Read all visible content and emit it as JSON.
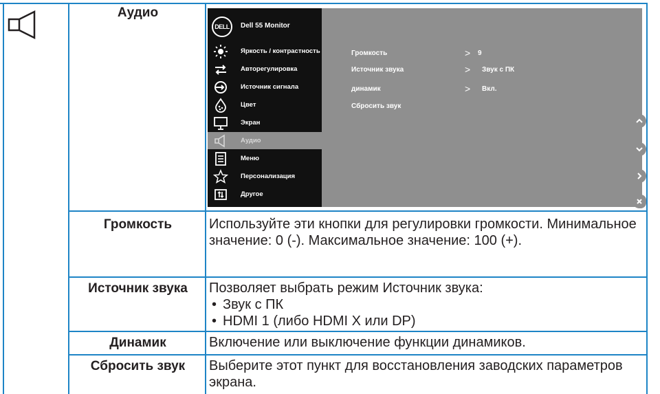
{
  "title": "Аудио",
  "osd": {
    "brand_logo": "DELL",
    "monitor_title": "Dell 55 Monitor",
    "menu_items": [
      {
        "icon": "brightness-icon",
        "label": "Яркость / контрастность"
      },
      {
        "icon": "auto-adjust-icon",
        "label": "Авторегулировка"
      },
      {
        "icon": "input-source-icon",
        "label": "Источник сигнала"
      },
      {
        "icon": "color-icon",
        "label": "Цвет"
      },
      {
        "icon": "display-icon",
        "label": "Экран"
      },
      {
        "icon": "speaker-icon",
        "label": "Аудио",
        "active": true
      },
      {
        "icon": "menu-icon",
        "label": "Меню"
      },
      {
        "icon": "star-icon",
        "label": "Персонализация"
      },
      {
        "icon": "others-icon",
        "label": "Другое"
      }
    ],
    "submenu": [
      {
        "name": "Громкость",
        "value": "9"
      },
      {
        "name": "Источник звука",
        "value": "Звук с ПК"
      },
      {
        "name": "динамик",
        "value": "Вкл."
      },
      {
        "name": "Сбросить звук",
        "value": ""
      }
    ],
    "nav_buttons": [
      "up",
      "down",
      "right",
      "exit"
    ]
  },
  "rows": [
    {
      "label": "Громкость",
      "description": "Используйте эти кнопки для регулировки громкости. Минимальное значение: 0 (-). Максимальное значение: 100 (+)."
    },
    {
      "label": "Источник звука",
      "description": "Позволяет выбрать режим Источник звука:",
      "bullets": [
        "Звук с ПК",
        "HDMI 1 (либо HDMI X или DP)"
      ]
    },
    {
      "label": "Динамик",
      "description": "Включение или выключение функции динамиков."
    },
    {
      "label": "Сбросить звук",
      "description": "Выберите этот пункт для восстановления заводских параметров экрана."
    }
  ],
  "colors": {
    "rule": "#1d84c6",
    "osd_menu_bg": "#111111",
    "osd_sub_bg": "#8f8f8f",
    "text": "#231f20"
  }
}
